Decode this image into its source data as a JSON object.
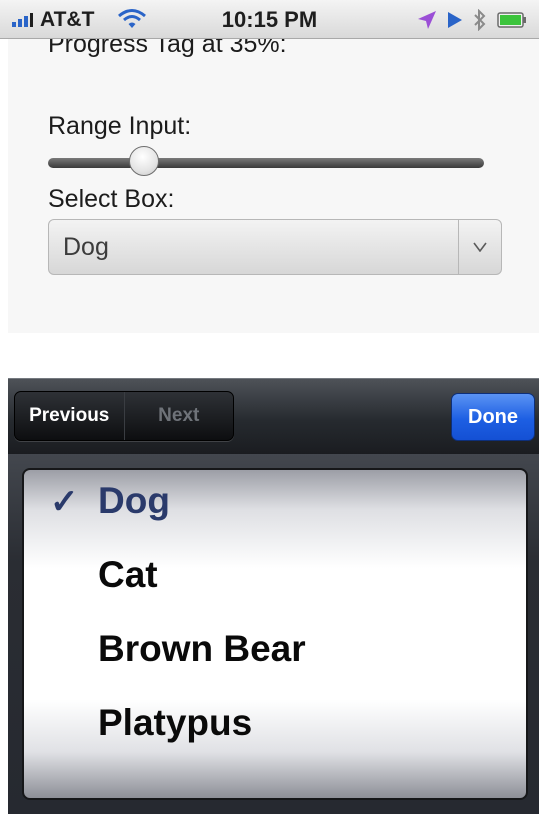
{
  "status_bar": {
    "carrier": "AT&T",
    "time": "10:15 PM",
    "icons": [
      "signal-bars-icon",
      "wifi-icon",
      "location-arrow-icon",
      "play-icon",
      "bluetooth-icon",
      "battery-icon"
    ],
    "colors": {
      "signal": "#2a64c8",
      "location": "#9b4fd6",
      "play": "#2a64c8",
      "battery": "#3cc43c"
    }
  },
  "form": {
    "progress_label": "Progress Tag at 35%:",
    "range_label": "Range Input:",
    "range_value": 0.22,
    "select_label": "Select Box:",
    "select_value": "Dog"
  },
  "toolbar": {
    "previous_label": "Previous",
    "next_label": "Next",
    "done_label": "Done",
    "done_color": "#1d5fe3"
  },
  "picker": {
    "checkmark": "✓",
    "options": [
      {
        "label": "Dog",
        "selected": true
      },
      {
        "label": "Cat",
        "selected": false
      },
      {
        "label": "Brown Bear",
        "selected": false
      },
      {
        "label": "Platypus",
        "selected": false
      }
    ]
  }
}
